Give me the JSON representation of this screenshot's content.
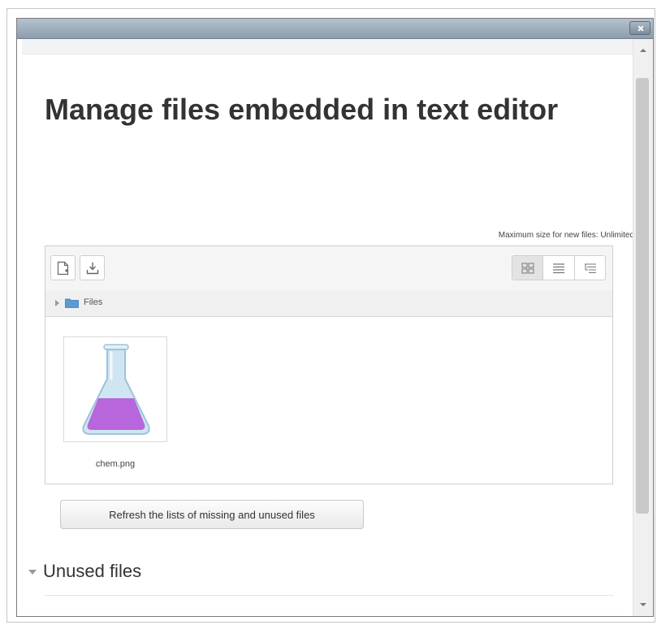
{
  "dialog": {
    "close_label": "×"
  },
  "page": {
    "title": "Manage files embedded in text editor",
    "max_size": "Maximum size for new files: Unlimited"
  },
  "filemanager": {
    "toolbar": {
      "add_icon": "add-file-icon",
      "download_icon": "download-icon",
      "views": [
        {
          "icon": "grid-view-icon",
          "active": true
        },
        {
          "icon": "list-view-icon",
          "active": false
        },
        {
          "icon": "tree-view-icon",
          "active": false
        }
      ]
    },
    "path": {
      "label": "Files"
    },
    "files": [
      {
        "name": "chem.png",
        "icon": "flask-icon"
      }
    ]
  },
  "actions": {
    "refresh_label": "Refresh the lists of missing and unused files"
  },
  "section": {
    "title": "Unused files"
  },
  "colors": {
    "flask_liquid": "#b866dc",
    "flask_glass": "#cfe5f2",
    "folder": "#5b9bd5"
  }
}
